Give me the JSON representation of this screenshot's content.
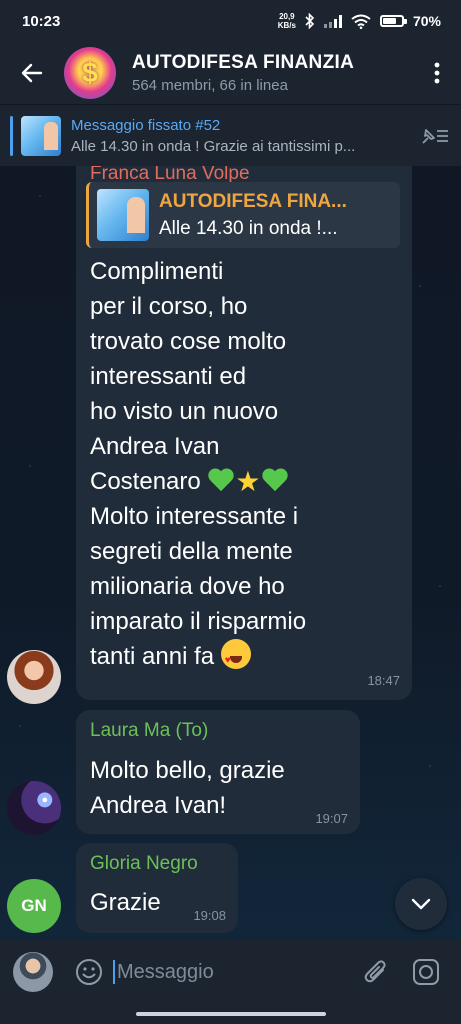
{
  "status_bar": {
    "time": "10:23",
    "net_speed_value": "20,9",
    "net_speed_unit": "KB/s",
    "battery": "70%",
    "battery_level": 0.7
  },
  "header": {
    "title": "AUTODIFESA FINANZIA",
    "subtitle": "564 membri, 66 in linea",
    "avatar_glyph": "$"
  },
  "pinned": {
    "title": "Messaggio fissato #52",
    "preview": "Alle 14.30 in onda ! Grazie ai tantissimi p..."
  },
  "messages": [
    {
      "sender": "Franca Luna Volpe",
      "sender_color": "#e26d5c",
      "reply": {
        "title": "AUTODIFESA FINA...",
        "body": "Alle 14.30 in onda !..."
      },
      "lines": [
        "Complimenti",
        "per il corso, ho",
        "trovato cose molto",
        "interessanti ed",
        "ho visto un nuovo",
        "Andrea Ivan",
        "Costenaro ",
        "Molto interessante i",
        "segreti della mente",
        "milionaria dove ho",
        "imparato il risparmio",
        "tanti anni fa "
      ],
      "time": "18:47"
    },
    {
      "sender": "Laura Ma (To)",
      "sender_color": "#6bc05a",
      "lines": [
        "Molto bello, grazie",
        "Andrea Ivan!"
      ],
      "time": "19:07"
    },
    {
      "sender": "Gloria Negro",
      "sender_color": "#6bc05a",
      "lines": [
        "Grazie"
      ],
      "time": "19:08",
      "avatar_initials": "GN"
    }
  ],
  "composer": {
    "placeholder": "Messaggio"
  },
  "colors": {
    "accent": "#4d9ff0",
    "bubble": "#212c3a",
    "bar": "#1c2430",
    "reply_accent": "#f0a640"
  }
}
